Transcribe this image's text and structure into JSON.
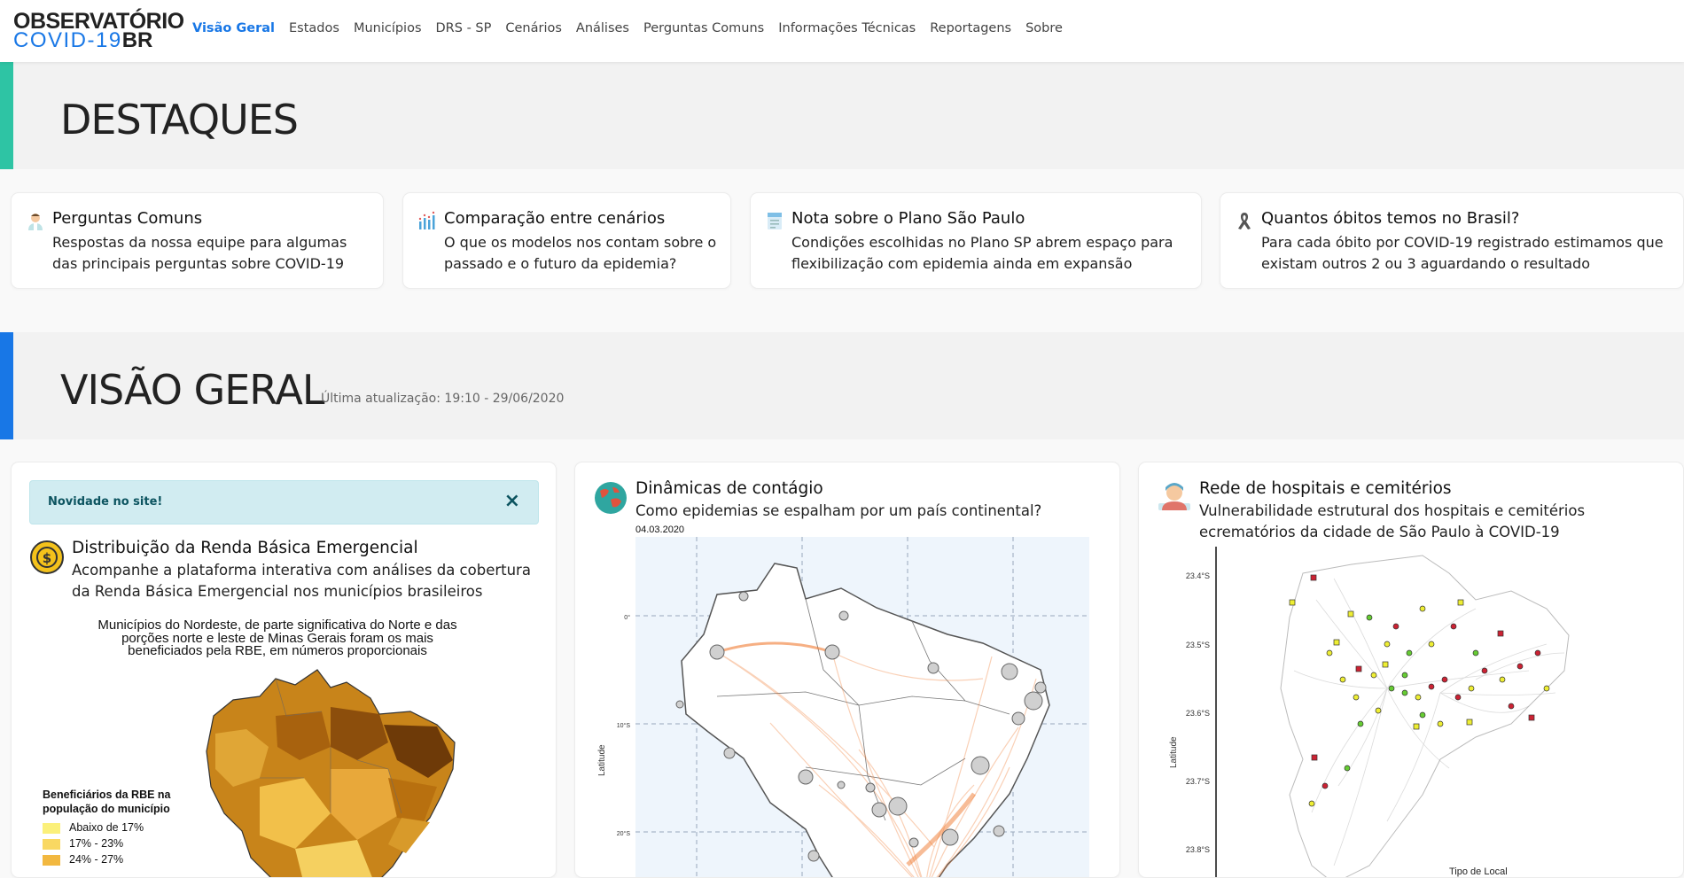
{
  "nav": {
    "logo_line1": "OBSERVATÓRIO",
    "logo_line2_a": "COVID-19",
    "logo_line2_b": "BR",
    "items": [
      "Visão Geral",
      "Estados",
      "Municípios",
      "DRS - SP",
      "Cenários",
      "Análises",
      "Perguntas Comuns",
      "Informações Técnicas",
      "Reportagens",
      "Sobre"
    ],
    "active": "Visão Geral"
  },
  "destaques": {
    "title": "DESTAQUES",
    "accent": "#2ec4a4",
    "cards": [
      {
        "title": "Perguntas Comuns",
        "text": "Respostas da nossa equipe para algumas das principais perguntas sobre COVID-19",
        "icon": "doctor-icon"
      },
      {
        "title": "Comparação entre cenários",
        "text": "O que os modelos nos contam sobre o passado e o futuro da epidemia?",
        "icon": "chart-bars-icon"
      },
      {
        "title": "Nota sobre o Plano São Paulo",
        "text": "Condições escolhidas no Plano SP abrem espaço para flexibilização com epidemia ainda em expansão",
        "icon": "document-icon"
      },
      {
        "title": "Quantos óbitos temos no Brasil?",
        "text": "Para cada óbito por COVID-19 registrado estimamos que existam outros 2 ou 3 aguardando o resultado",
        "icon": "ribbon-icon"
      }
    ]
  },
  "visao": {
    "title": "VISÃO GERAL",
    "accent": "#1877e6",
    "updated": "Última atualização: 19:10 - 29/06/2020"
  },
  "panel_rbe": {
    "alert": "Novidade no site!",
    "close": "×",
    "title": "Distribuição da Renda Básica Emergencial",
    "subtitle": "Acompanhe a plataforma interativa com análises da cobertura da Renda Básica Emergencial nos municípios brasileiros",
    "map_caption": "Municípios do Nordeste, de parte significativa do Norte e das porções norte e leste de Minas Gerais foram os mais beneficiados pela RBE, em números proporcionais",
    "legend_title": "Beneficiários da RBE na população do município",
    "legend": [
      {
        "label": "Abaixo de 17%",
        "color": "#fbf07a"
      },
      {
        "label": "17% - 23%",
        "color": "#f9d862"
      },
      {
        "label": "24% - 27%",
        "color": "#f2b840"
      }
    ]
  },
  "panel_contagio": {
    "title": "Dinâmicas de contágio",
    "subtitle": "Como epidemias se espalham por um país continental?",
    "date": "04.03.2020",
    "ylabel": "Latitude",
    "ticks": [
      "0°",
      "10°S",
      "20°S"
    ]
  },
  "panel_hospitais": {
    "title": "Rede de hospitais e cemitérios",
    "subtitle": "Vulnerabilidade estrutural dos hospitais e cemitérios ecrematórios da cidade de São Paulo à COVID-19",
    "ylabel": "Latitude",
    "ticks": [
      "23.4°S",
      "23.5°S",
      "23.6°S",
      "23.7°S",
      "23.8°S"
    ],
    "legend_title": "Tipo de Local"
  }
}
